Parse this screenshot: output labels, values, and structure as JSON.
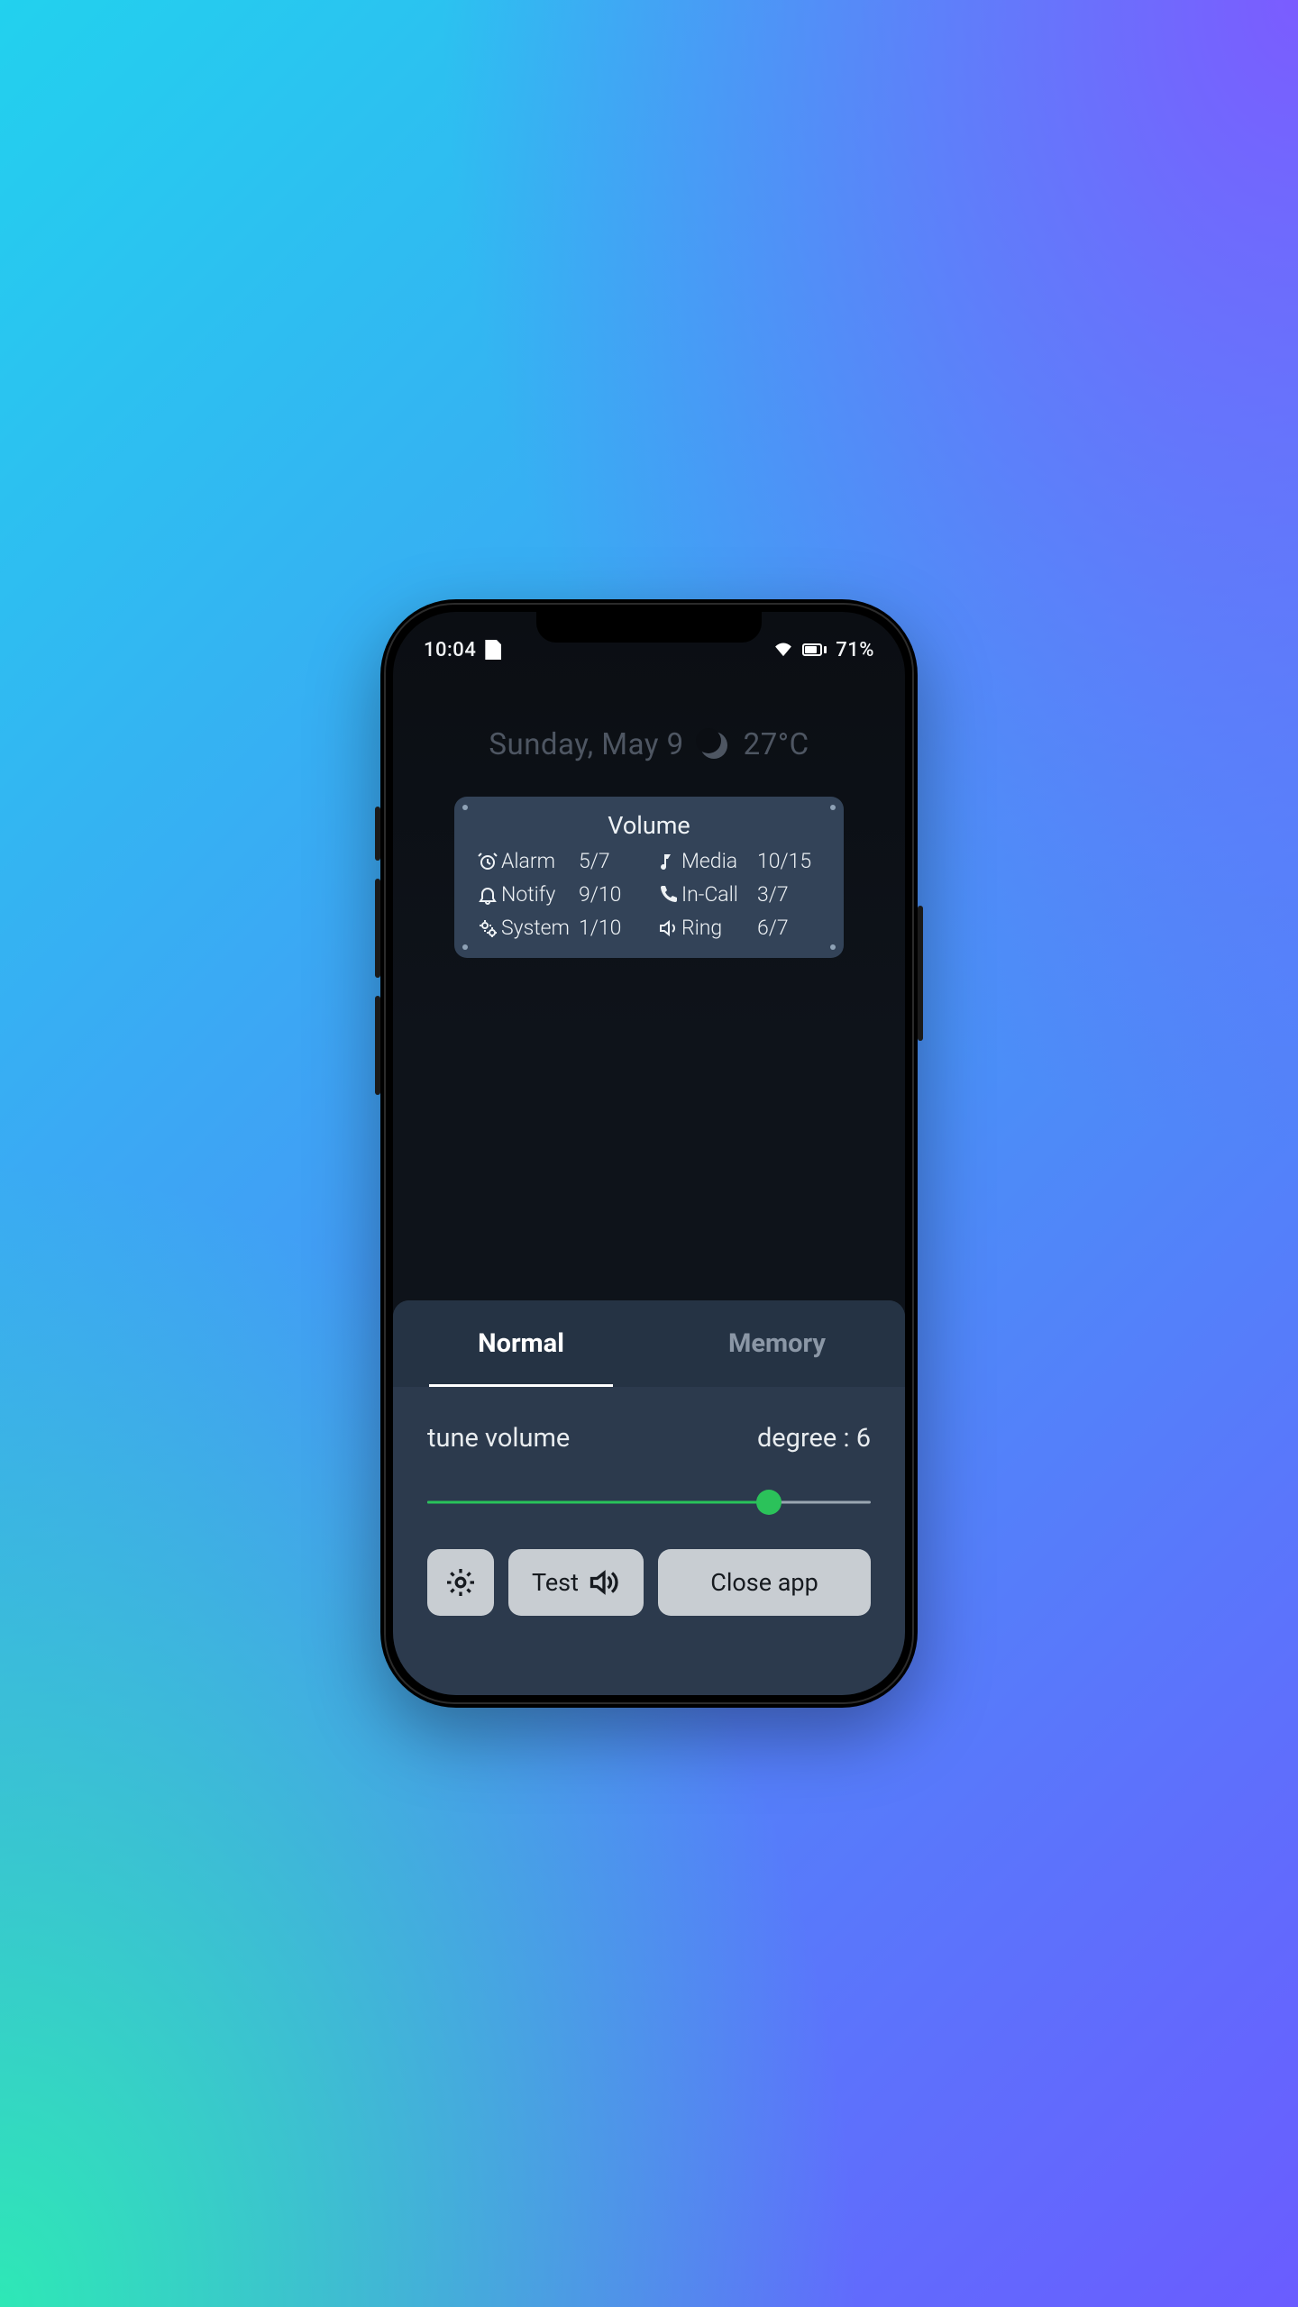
{
  "statusbar": {
    "time": "10:04",
    "battery_text": "71%"
  },
  "dateline": {
    "date": "Sunday, May 9",
    "temp": "27°C"
  },
  "volume_card": {
    "title": "Volume",
    "rows": [
      {
        "icon": "alarm-icon",
        "label": "Alarm",
        "value": "5/7"
      },
      {
        "icon": "music-icon",
        "label": "Media",
        "value": "10/15"
      },
      {
        "icon": "bell-icon",
        "label": "Notify",
        "value": "9/10"
      },
      {
        "icon": "phone-icon",
        "label": "In-Call",
        "value": "3/7"
      },
      {
        "icon": "gears-icon",
        "label": "System",
        "value": "1/10"
      },
      {
        "icon": "speaker-icon",
        "label": "Ring",
        "value": "6/7"
      }
    ]
  },
  "sheet": {
    "tabs": {
      "normal": "Normal",
      "memory": "Memory",
      "active": "normal"
    },
    "tune_label": "tune volume",
    "degree_label": "degree : 6",
    "degree_value": 6,
    "degree_max": 8,
    "buttons": {
      "test": "Test",
      "close": "Close app"
    }
  }
}
